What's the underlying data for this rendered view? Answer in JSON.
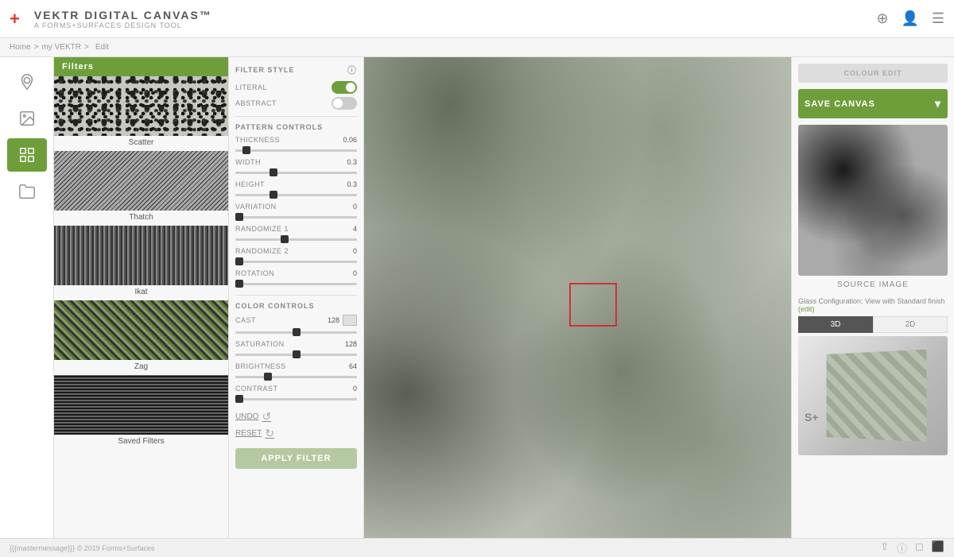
{
  "header": {
    "logo_plus": "+",
    "title_main": "VEKTR DIGITAL CANVAS™",
    "title_sub": "A FORMS+SURFACES DESIGN TOOL"
  },
  "breadcrumb": {
    "home": "Home",
    "separator1": ">",
    "my_vektr": "my VEKTR",
    "separator2": ">",
    "edit": "Edit"
  },
  "nav_icons": [
    {
      "name": "location-icon",
      "symbol": "📍",
      "active": false
    },
    {
      "name": "gallery-icon",
      "symbol": "🖼",
      "active": false
    },
    {
      "name": "grid-icon",
      "symbol": "▦",
      "active": true
    },
    {
      "name": "folder-icon",
      "symbol": "📁",
      "active": false
    }
  ],
  "filter_sidebar": {
    "header": "Filters",
    "items": [
      {
        "name": "scatter",
        "label": "Scatter",
        "type": "scatter"
      },
      {
        "name": "thatch",
        "label": "Thatch",
        "type": "thatch"
      },
      {
        "name": "ikat",
        "label": "Ikat",
        "type": "ikat"
      },
      {
        "name": "zag",
        "label": "Zag",
        "type": "zag"
      },
      {
        "name": "saved-filters",
        "label": "Saved Filters",
        "type": "saved"
      }
    ]
  },
  "filter_style": {
    "title": "FILTER STYLE",
    "literal_label": "LITERAL",
    "literal_on": true,
    "abstract_label": "ABSTRACT",
    "abstract_on": false
  },
  "pattern_controls": {
    "title": "PATTERN CONTROLS",
    "thickness": {
      "label": "THICKNESS",
      "value": 0.06,
      "min": 0,
      "max": 1,
      "pos": 6
    },
    "width": {
      "label": "WIDTH",
      "value": 0.3,
      "min": 0,
      "max": 1,
      "pos": 30
    },
    "height": {
      "label": "HEIGHT",
      "value": 0.3,
      "min": 0,
      "max": 1,
      "pos": 30
    },
    "variation": {
      "label": "VARIATION",
      "value": 0,
      "min": 0,
      "max": 10,
      "pos": 0
    },
    "randomize1": {
      "label": "RANDOMIZE 1",
      "value": 4,
      "min": 0,
      "max": 10,
      "pos": 40
    },
    "randomize2": {
      "label": "RANDOMIZE 2",
      "value": 0,
      "min": 0,
      "max": 10,
      "pos": 0
    },
    "rotation": {
      "label": "ROTATION",
      "value": 0,
      "min": 0,
      "max": 360,
      "pos": 0
    }
  },
  "color_controls": {
    "title": "COLOR CONTROLS",
    "cast": {
      "label": "CAST",
      "value": 128,
      "min": 0,
      "max": 255,
      "pos": 50
    },
    "saturation": {
      "label": "SATURATION",
      "value": 128,
      "min": 0,
      "max": 255,
      "pos": 50
    },
    "brightness": {
      "label": "BRIGHTNESS",
      "value": 64,
      "min": 0,
      "max": 255,
      "pos": 25
    },
    "contrast": {
      "label": "CONTRAST",
      "value": 0,
      "min": 0,
      "max": 255,
      "pos": 0
    }
  },
  "actions": {
    "undo": "UNDO",
    "reset": "RESET",
    "apply_filter": "APPLY FILTER"
  },
  "right_panel": {
    "color_edit_label": "COLOUR EDIT",
    "save_canvas_label": "SAVE CANVAS",
    "source_image_label": "SOURCE IMAGE",
    "glass_config_label": "Glass Configuration: View with Standard finish",
    "edit_link": "(edit)",
    "tab_3d": "3D",
    "tab_2d": "2D",
    "splus_badge": "S+"
  },
  "footer": {
    "message": "{{{mastermessage}}}",
    "copyright": "© 2019 Forms+Surfaces"
  }
}
